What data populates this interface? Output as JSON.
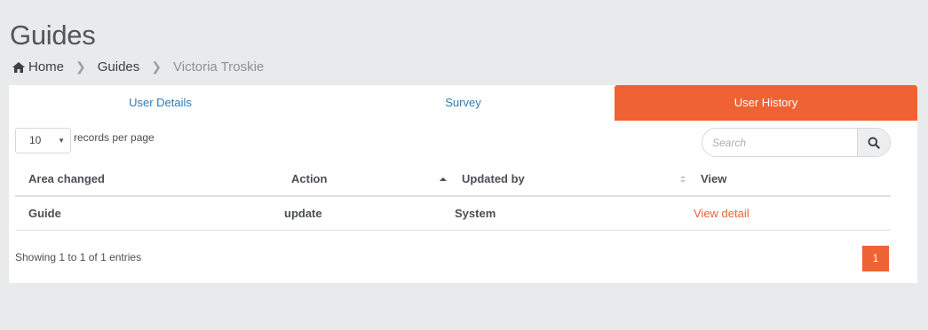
{
  "page": {
    "title": "Guides"
  },
  "breadcrumb": {
    "home": "Home",
    "section": "Guides",
    "current": "Victoria Troskie"
  },
  "tabs": [
    {
      "label": "User Details",
      "active": false
    },
    {
      "label": "Survey",
      "active": false
    },
    {
      "label": "User History",
      "active": true
    }
  ],
  "controls": {
    "page_length": "10",
    "page_length_label": "records per page",
    "search_placeholder": "Search"
  },
  "table": {
    "columns": [
      "Area changed",
      "Action",
      "Updated by",
      "View"
    ],
    "rows": [
      {
        "area": "Guide",
        "action": "update",
        "updated_by": "System",
        "view": "View detail"
      }
    ]
  },
  "footer": {
    "info": "Showing 1 to 1 of 1 entries",
    "current_page": "1"
  },
  "colors": {
    "accent": "#ef6233",
    "link": "#2e7bb6",
    "background": "#e8eaeb"
  }
}
